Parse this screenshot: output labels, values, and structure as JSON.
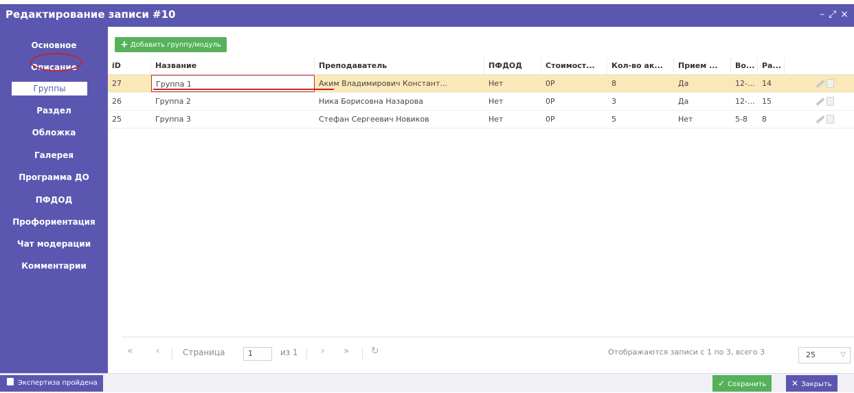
{
  "window": {
    "title": "Редактирование записи #10",
    "controls": {
      "minimize": "–",
      "maximize": "⤢",
      "close": "×"
    }
  },
  "sidebar": {
    "items": [
      {
        "label": "Основное"
      },
      {
        "label": "Описание"
      },
      {
        "label": "Группы",
        "active": true
      },
      {
        "label": "Раздел"
      },
      {
        "label": "Обложка"
      },
      {
        "label": "Галерея"
      },
      {
        "label": "Программа ДО"
      },
      {
        "label": "ПФДОД"
      },
      {
        "label": "Профориентация"
      },
      {
        "label": "Чат модерации"
      },
      {
        "label": "Комментарии"
      }
    ]
  },
  "toolbar": {
    "add_label": "Добавить группу/модуль"
  },
  "table": {
    "columns": [
      "iD",
      "Название",
      "Преподаватель",
      "ПФДОД",
      "Стоимост...",
      "Кол-во ак...",
      "Прием ...",
      "Во...",
      "Ра..."
    ],
    "rows": [
      {
        "id": "27",
        "name": "Группа 1",
        "teacher": "Аким Владимирович Констант...",
        "pfdod": "Нет",
        "cost": "0Р",
        "count": "8",
        "admission": "Да",
        "age": "12-...",
        "ra": "14",
        "selected": true
      },
      {
        "id": "26",
        "name": "Группа 2",
        "teacher": "Ника Борисовна Назарова",
        "pfdod": "Нет",
        "cost": "0Р",
        "count": "3",
        "admission": "Да",
        "age": "12-...",
        "ra": "15",
        "selected": false
      },
      {
        "id": "25",
        "name": "Группа 3",
        "teacher": "Стефан Сергеевич Новиков",
        "pfdod": "Нет",
        "cost": "0Р",
        "count": "5",
        "admission": "Нет",
        "age": "5-8",
        "ra": "8",
        "selected": false
      }
    ]
  },
  "pager": {
    "page_label": "Страница",
    "page_value": "1",
    "of_label": "из 1",
    "status": "Отображаются записи с 1 по 3, всего 3",
    "page_size": "25"
  },
  "footer": {
    "expertise_label": "Экспертиза пройдена",
    "save_label": "Сохранить",
    "close_label": "Закрыть"
  },
  "colors": {
    "primary": "#5b57b0",
    "success": "#56b15b",
    "selected_row": "#fbe8b8",
    "annotation": "#c0262b"
  }
}
